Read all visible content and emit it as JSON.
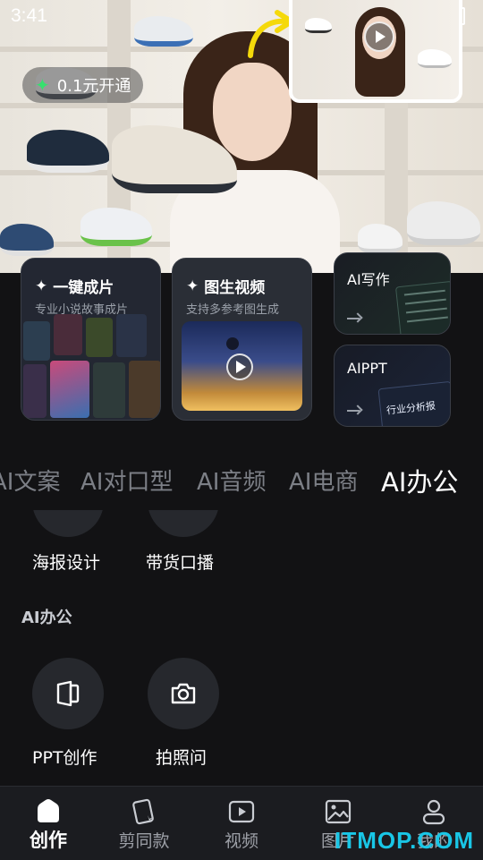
{
  "status_bar": {
    "time": "3:41"
  },
  "hero": {
    "vip_label": "0.1元开通"
  },
  "feature_cards": [
    {
      "title": "一键成片",
      "subtitle": "专业小说故事成片"
    },
    {
      "title": "图生视频",
      "subtitle": "支持多参考图生成"
    },
    {
      "title": "AI写作"
    },
    {
      "title": "AIPPT",
      "preview_text": "行业分析报"
    }
  ],
  "tabs": [
    "AI文案",
    "AI对口型",
    "AI音频",
    "AI电商",
    "AI办公"
  ],
  "active_tab": "AI办公",
  "tools_row1": [
    {
      "label": "海报设计"
    },
    {
      "label": "带货口播"
    }
  ],
  "section": {
    "title": "AI办公"
  },
  "tools_row2": [
    {
      "label": "PPT创作",
      "icon": "ppt-icon"
    },
    {
      "label": "拍照问",
      "icon": "camera-icon"
    }
  ],
  "bottom_nav": [
    {
      "label": "创作",
      "icon": "home-icon",
      "active": true
    },
    {
      "label": "剪同款",
      "icon": "template-icon"
    },
    {
      "label": "视频",
      "icon": "video-icon"
    },
    {
      "label": "图片",
      "icon": "image-icon"
    },
    {
      "label": "我的",
      "icon": "profile-icon"
    }
  ],
  "watermark": "ITMOP.COM",
  "colors": {
    "accent_green": "#36e06e",
    "background": "#121214",
    "watermark": "#19c6e6"
  }
}
